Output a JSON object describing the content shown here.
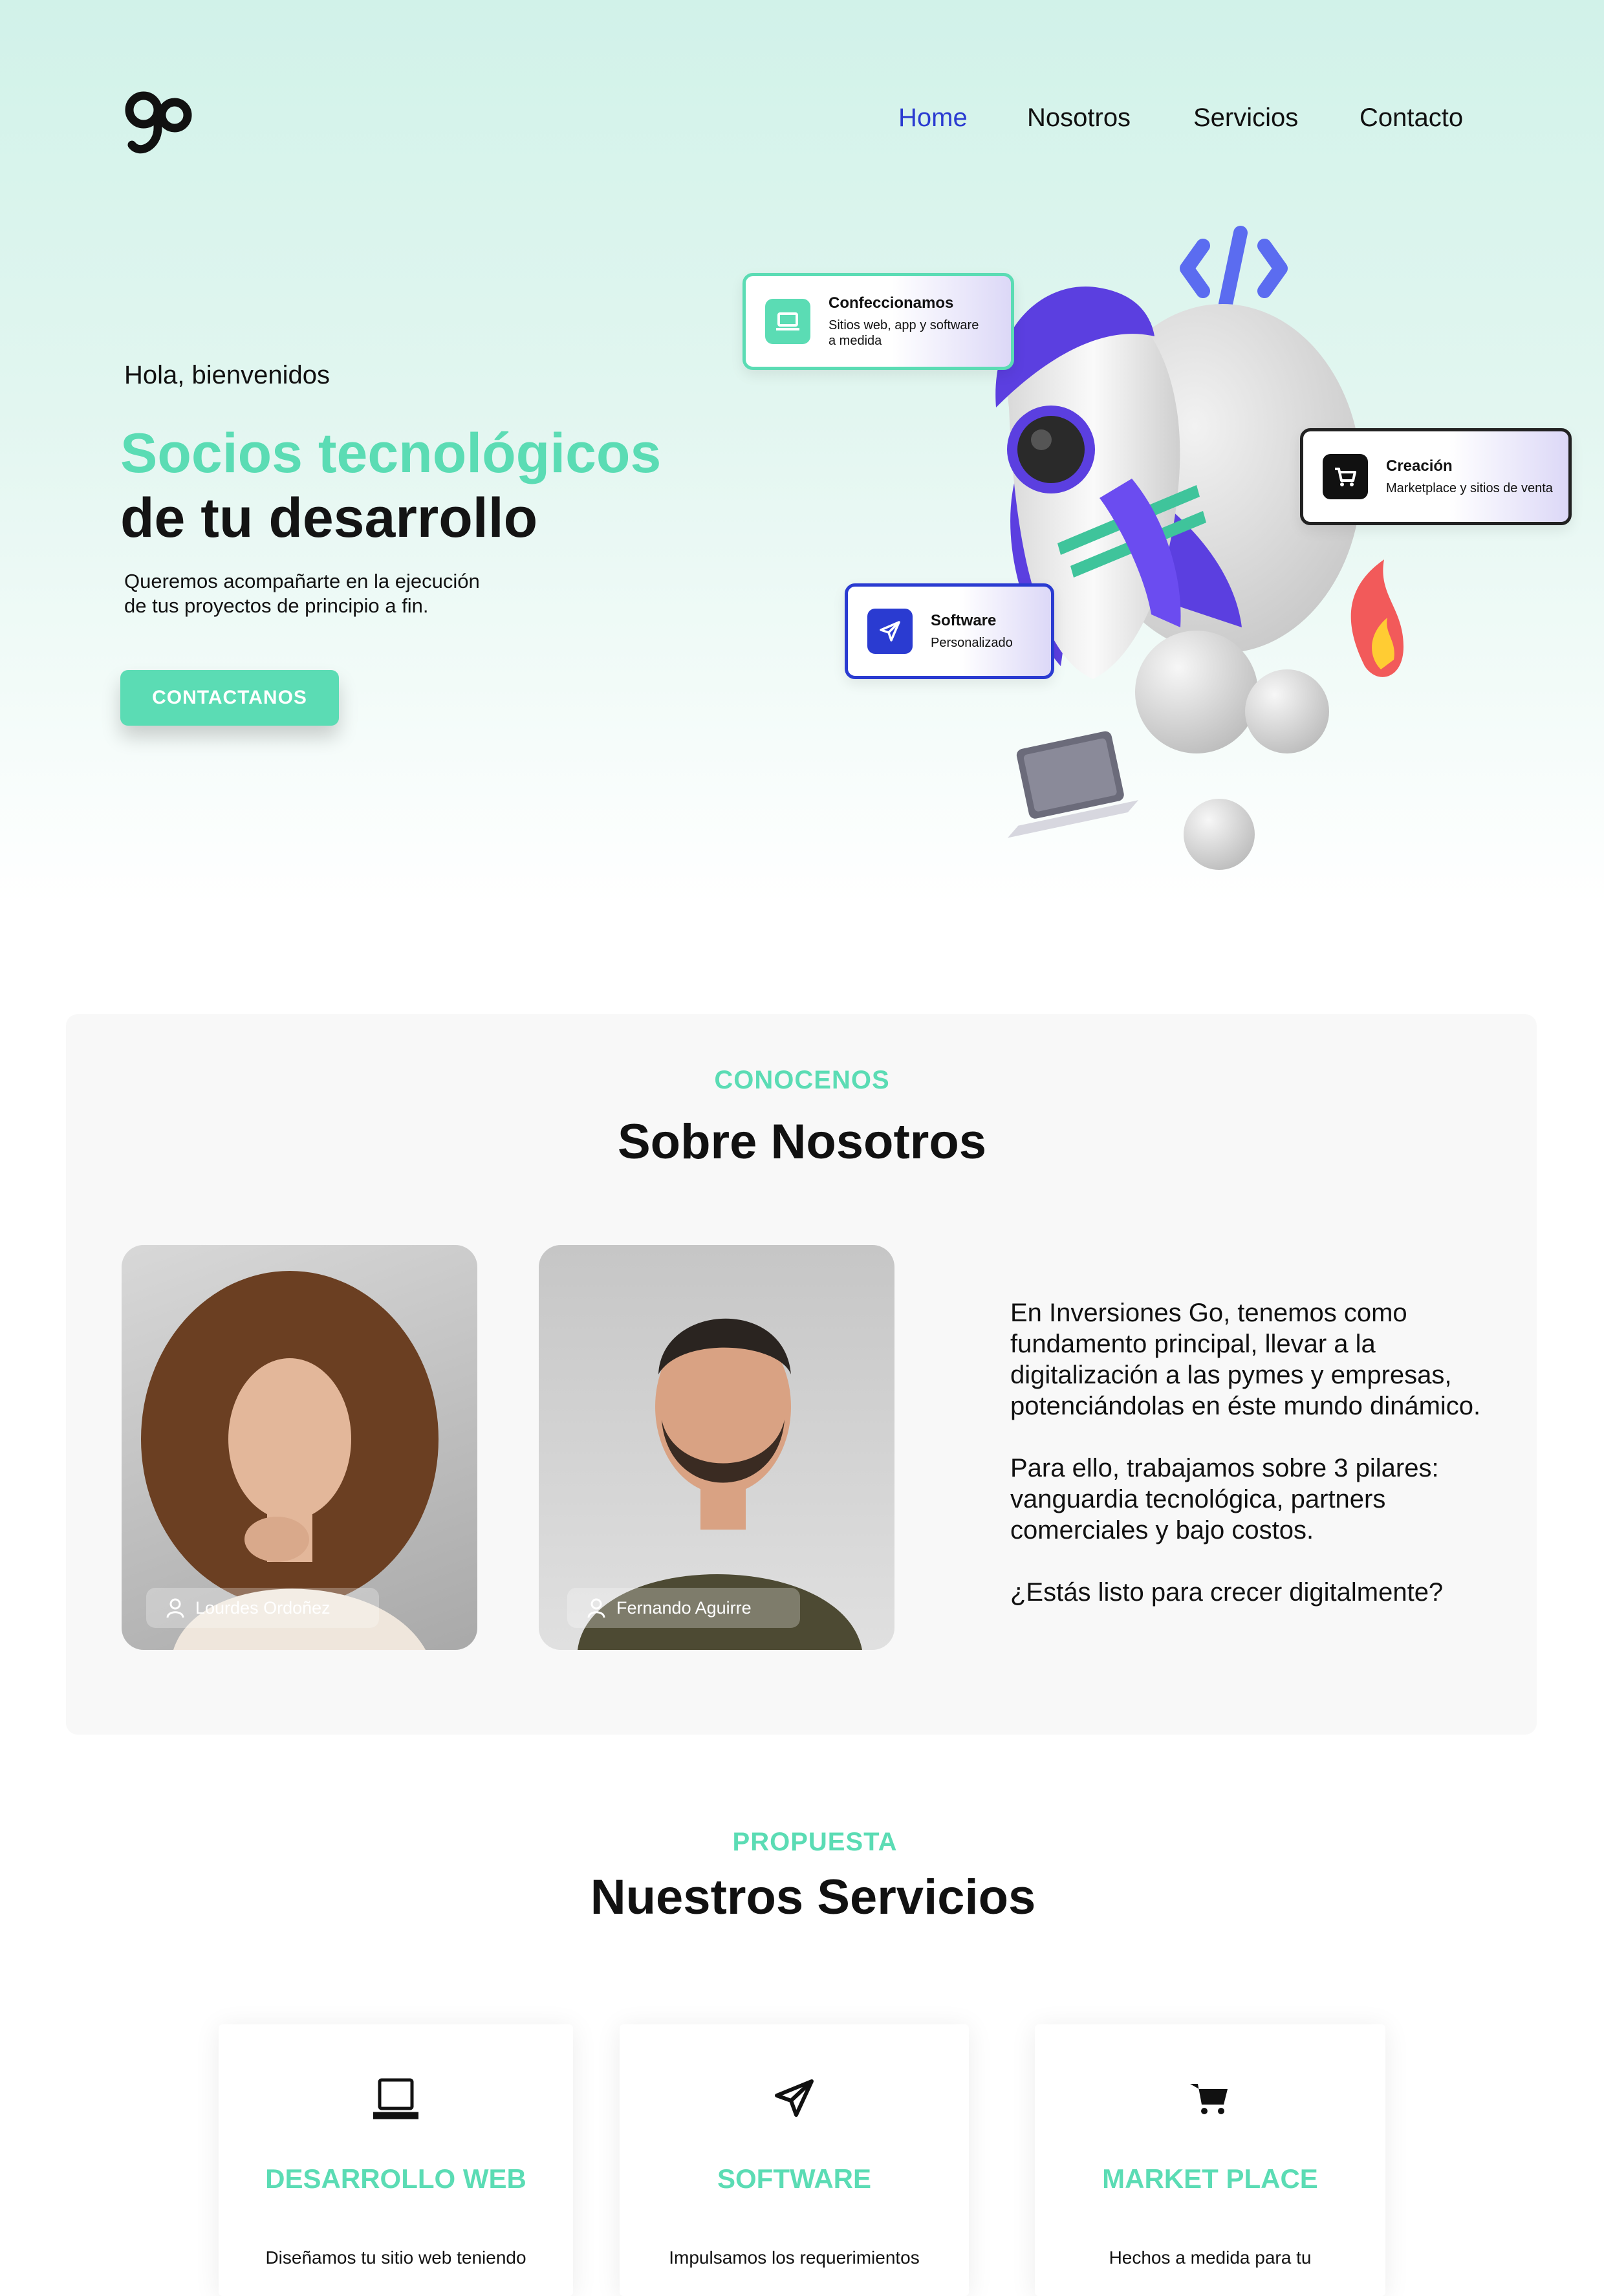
{
  "header": {
    "logo_text": "go",
    "nav": [
      {
        "label": "Home",
        "active": true
      },
      {
        "label": "Nosotros",
        "active": false
      },
      {
        "label": "Servicios",
        "active": false
      },
      {
        "label": "Contacto",
        "active": false
      }
    ]
  },
  "hero": {
    "greeting": "Hola, bienvenidos",
    "title_line1": "Socios tecnológicos",
    "title_line2": "de tu desarrollo",
    "subtitle_line1": "Queremos acompañarte en la ejecución",
    "subtitle_line2": "de tus proyectos de principio a fin.",
    "cta_label": "CONTACTANOS",
    "cards": [
      {
        "title": "Confeccionamos",
        "line1": "Sitios web, app y software",
        "line2": "a medida",
        "icon": "laptop-icon"
      },
      {
        "title": "Creación",
        "line1": "Marketplace y sitios de venta",
        "icon": "cart-icon"
      },
      {
        "title": "Software",
        "line1": "Personalizado",
        "icon": "paper-plane-icon"
      }
    ]
  },
  "about": {
    "eyebrow": "CONOCENOS",
    "title": "Sobre Nosotros",
    "members": [
      {
        "name": "Lourdes Ordoñez"
      },
      {
        "name": "Fernando Aguirre"
      }
    ],
    "paragraphs": [
      "En Inversiones Go, tenemos como fundamento principal, llevar a la digitalización a las pymes y empresas, potenciándolas en éste mundo dinámico.",
      "Para ello, trabajamos sobre 3 pilares: vanguardia tecnológica, partners comerciales y bajo costos.",
      "¿Estás listo para crecer digitalmente?"
    ]
  },
  "services": {
    "eyebrow": "PROPUESTA",
    "title": "Nuestros Servicios",
    "items": [
      {
        "title": "DESARROLLO WEB",
        "desc": "Diseñamos tu sitio web teniendo",
        "icon": "laptop-icon"
      },
      {
        "title": "SOFTWARE",
        "desc": "Impulsamos los requerimientos",
        "icon": "paper-plane-icon"
      },
      {
        "title": "MARKET PLACE",
        "desc": "Hechos a medida para tu",
        "icon": "cart-icon"
      }
    ]
  },
  "colors": {
    "accent": "#5bdcb4",
    "nav_active": "#2a3bd1",
    "rocket_purple": "#5b3fe0",
    "text": "#111111"
  }
}
